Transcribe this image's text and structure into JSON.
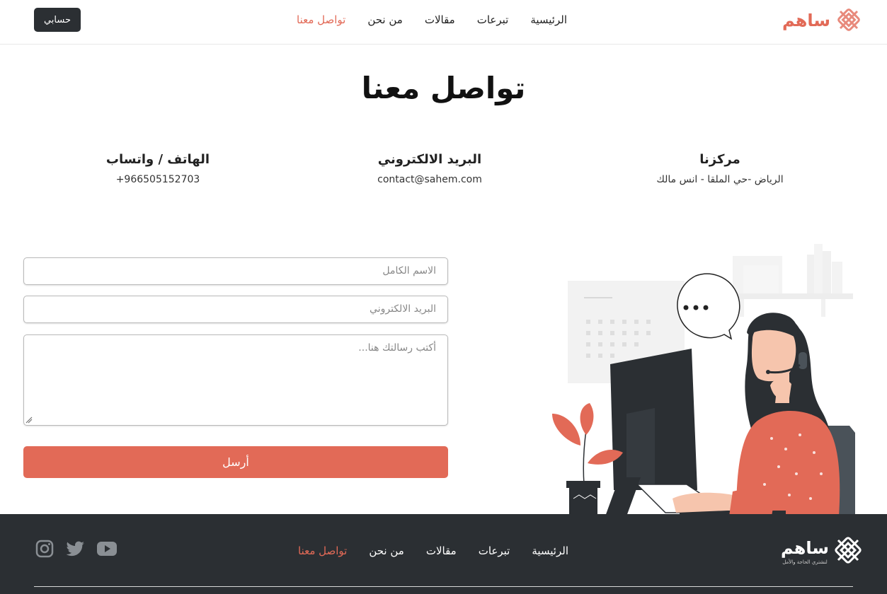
{
  "header": {
    "account_label": "حسابي",
    "nav": [
      {
        "label": "الرئيسية",
        "active": false
      },
      {
        "label": "تبرعات",
        "active": false
      },
      {
        "label": "مقالات",
        "active": false
      },
      {
        "label": "من نحن",
        "active": false
      },
      {
        "label": "تواصل معنا",
        "active": true
      }
    ],
    "logo_text": "ساهم"
  },
  "page": {
    "title": "تواصل معنا"
  },
  "contact": {
    "location": {
      "label": "مركزنا",
      "value": "الرياض -حي الملقا - انس مالك"
    },
    "email": {
      "label": "البريد الالكتروني",
      "value": "contact@sahem.com"
    },
    "phone": {
      "label": "الهاتف / واتساب",
      "value": "+966505152703"
    }
  },
  "form": {
    "name_placeholder": "الاسم الكامل",
    "email_placeholder": "البريد الالكتروني",
    "message_placeholder": "أكتب رسالتك هنا...",
    "submit_label": "أرسل"
  },
  "footer": {
    "nav": [
      {
        "label": "الرئيسية",
        "active": false
      },
      {
        "label": "تبرعات",
        "active": false
      },
      {
        "label": "مقالات",
        "active": false
      },
      {
        "label": "من نحن",
        "active": false
      },
      {
        "label": "تواصل معنا",
        "active": true
      }
    ],
    "logo_text": "ساهم",
    "logo_tagline": "لنشتري الحاجة والأمل",
    "socials": [
      "youtube-icon",
      "twitter-icon",
      "instagram-icon"
    ]
  },
  "colors": {
    "accent": "#e26a57",
    "dark": "#2b2f33"
  }
}
